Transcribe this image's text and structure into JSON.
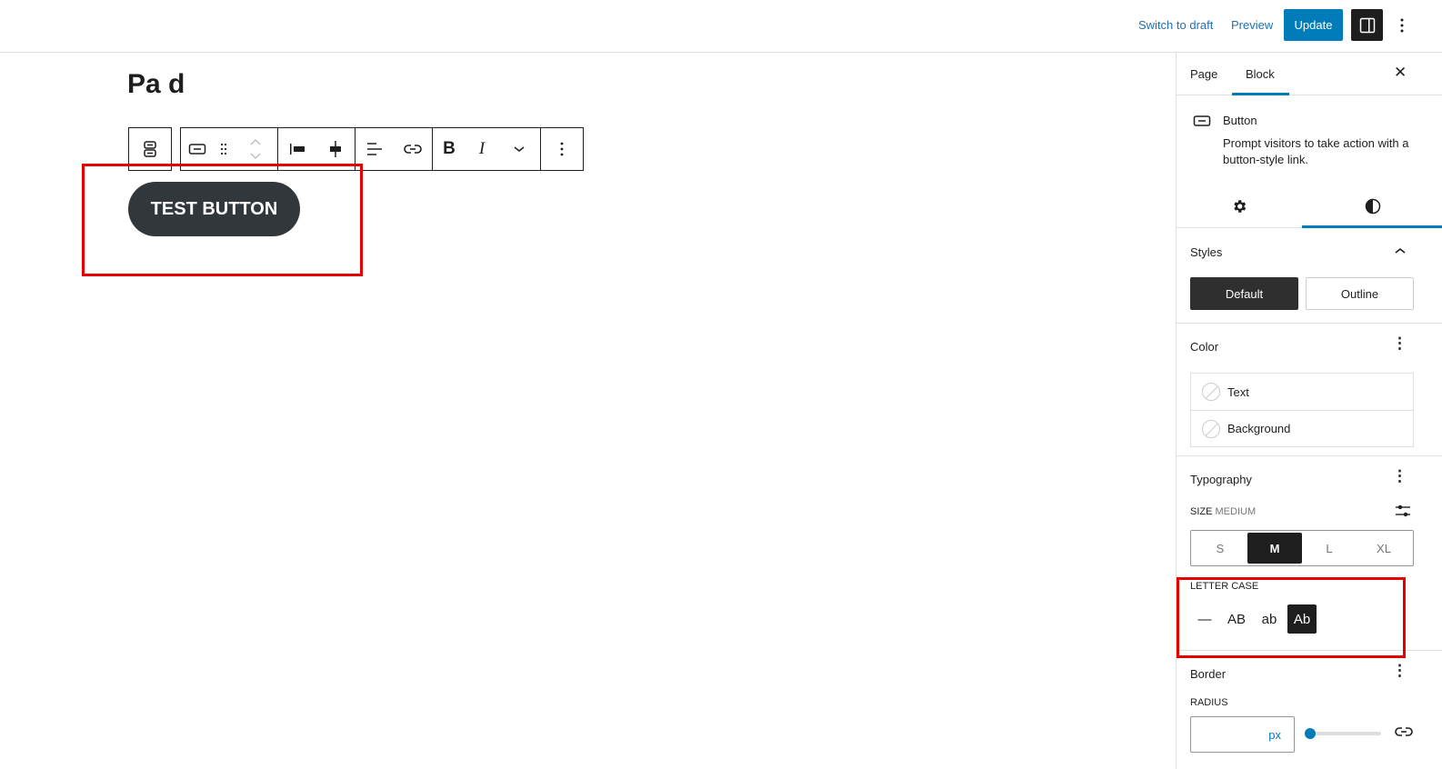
{
  "header": {
    "switch_to_draft": "Switch to draft",
    "preview": "Preview",
    "update": "Update",
    "sidebar_toggle_icon": "sidebar-toggle-icon",
    "more_icon": "more-vertical-icon"
  },
  "canvas": {
    "title_fragment": "Pa  d",
    "button_text": "TEST BUTTON",
    "toolbar_icons": [
      "buttons-parent-icon",
      "button-block-icon",
      "drag-handle-icon",
      "move-up-down-icon",
      "justify-left-icon",
      "justify-center-icon",
      "align-icon",
      "link-icon",
      "bold-icon",
      "italic-icon",
      "more-formatting-chevron-icon",
      "options-vertical-icon"
    ]
  },
  "sidebar": {
    "tabs": [
      {
        "label": "Page"
      },
      {
        "label": "Block"
      }
    ],
    "active_tab": "Block",
    "block": {
      "name": "Button",
      "description": "Prompt visitors to take action with a button-style link."
    },
    "subtabs": [
      "settings-gear-icon",
      "styles-contrast-icon"
    ],
    "styles": {
      "title": "Styles",
      "options": [
        {
          "label": "Default"
        },
        {
          "label": "Outline"
        }
      ],
      "selected": "Default"
    },
    "color": {
      "title": "Color",
      "items": [
        {
          "label": "Text"
        },
        {
          "label": "Background"
        }
      ]
    },
    "typography": {
      "title": "Typography",
      "size_label": "SIZE",
      "size_value": "MEDIUM",
      "sizes": [
        {
          "label": "S"
        },
        {
          "label": "M"
        },
        {
          "label": "L"
        },
        {
          "label": "XL"
        }
      ],
      "selected_size": "M",
      "letter_case_label": "LETTER CASE",
      "letter_cases": [
        {
          "label": "—"
        },
        {
          "label": "AB"
        },
        {
          "label": "ab"
        },
        {
          "label": "Ab"
        }
      ],
      "selected_case": "Ab"
    },
    "border": {
      "title": "Border",
      "radius_label": "RADIUS",
      "radius_value": "",
      "radius_unit": "px",
      "radius_slider_fraction": 0
    }
  },
  "colors": {
    "accent": "#007cba",
    "dark": "#1e1e1e",
    "button_bg": "#32373c",
    "highlight": "#e60000"
  }
}
